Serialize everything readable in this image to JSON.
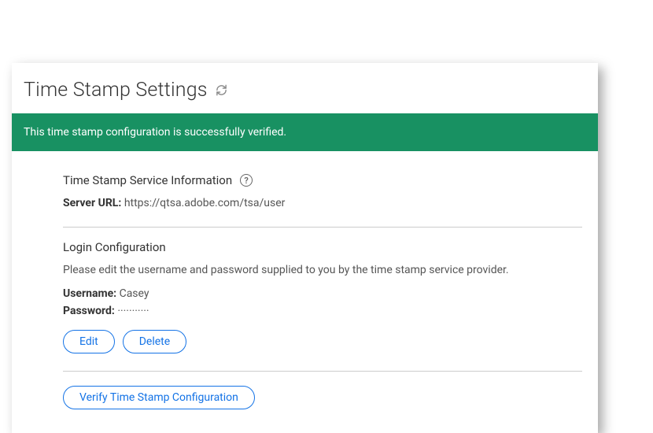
{
  "page": {
    "title": "Time Stamp Settings"
  },
  "banner": {
    "success_message": "This time stamp configuration is successfully verified."
  },
  "service_info": {
    "section_title": "Time Stamp Service Information",
    "server_url_label": "Server URL:",
    "server_url_value": "https://qtsa.adobe.com/tsa/user"
  },
  "login_config": {
    "section_title": "Login Configuration",
    "hint": "Please edit the username and password supplied to you by the time stamp service provider.",
    "username_label": "Username:",
    "username_value": "Casey",
    "password_label": "Password:",
    "password_value": "···········"
  },
  "buttons": {
    "edit_label": "Edit",
    "delete_label": "Delete",
    "verify_label": "Verify Time Stamp Configuration"
  }
}
